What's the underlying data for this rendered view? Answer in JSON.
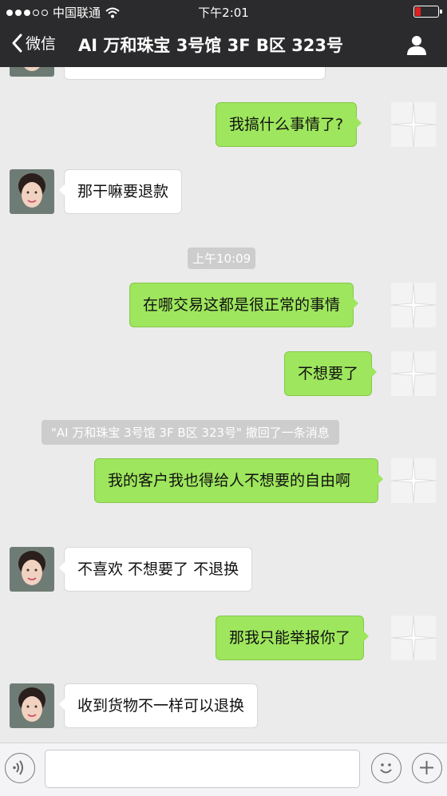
{
  "status_bar": {
    "carrier": "中国联通",
    "time": "下午2:01",
    "battery_color": "#e02020"
  },
  "nav": {
    "back_label": "微信",
    "title": "AI 万和珠宝  3号馆 3F B区 323号",
    "profile_icon": "person-icon"
  },
  "messages": [
    {
      "side": "out",
      "text": "我搞什么事情了?"
    },
    {
      "side": "in",
      "text": "那干嘛要退款"
    },
    {
      "side": "time",
      "text": "上午10:09"
    },
    {
      "side": "out",
      "text": "在哪交易这都是很正常的事情"
    },
    {
      "side": "out",
      "text": "不想要了"
    },
    {
      "side": "system",
      "text": "\"AI 万和珠宝  3号馆 3F B区 323号\" 撤回了一条消息"
    },
    {
      "side": "out",
      "text": "我的客户我也得给人不想要的自由啊"
    },
    {
      "side": "in",
      "text": "不喜欢 不想要了 不退换"
    },
    {
      "side": "out",
      "text": "那我只能举报你了"
    },
    {
      "side": "in",
      "text": "收到货物不一样可以退换"
    }
  ],
  "input": {
    "placeholder": ""
  },
  "colors": {
    "bar": "#2b2b2d",
    "chat_bg": "#ebebeb",
    "out_bubble": "#9ee65d",
    "in_bubble": "#ffffff"
  }
}
